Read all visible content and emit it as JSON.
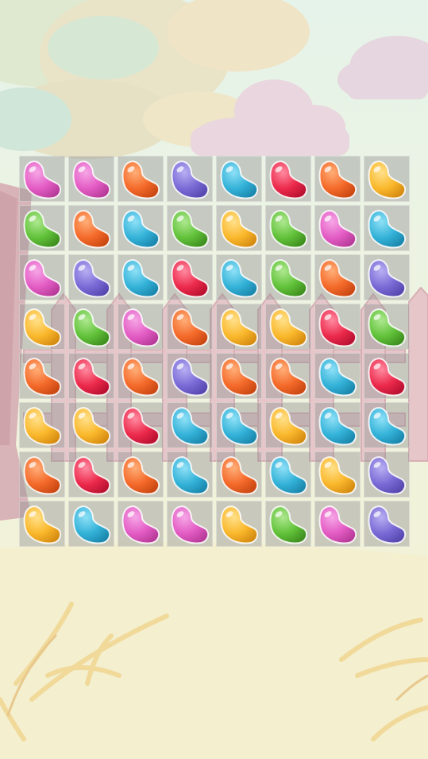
{
  "game": {
    "colors": {
      "pink": {
        "base": "#e35cc4",
        "light": "#f6a6e6",
        "dark": "#b63a98"
      },
      "orange": {
        "base": "#f46a2a",
        "light": "#ffae78",
        "dark": "#c94712"
      },
      "purple": {
        "base": "#7a6ad6",
        "light": "#b8aef2",
        "dark": "#5646ae"
      },
      "cyan": {
        "base": "#34b2d8",
        "light": "#8ee0f6",
        "dark": "#1a86ac"
      },
      "red": {
        "base": "#ec2a4c",
        "light": "#ff8aa0",
        "dark": "#b81030"
      },
      "green": {
        "base": "#62c23a",
        "light": "#aee890",
        "dark": "#3e8e1e"
      },
      "yellow": {
        "base": "#fab82c",
        "light": "#ffe08a",
        "dark": "#d48a10"
      }
    },
    "board": [
      [
        "pink",
        "pink",
        "orange",
        "purple",
        "cyan",
        "red",
        "orange",
        "yellow"
      ],
      [
        "green",
        "orange",
        "cyan",
        "green",
        "yellow",
        "green",
        "pink",
        "cyan"
      ],
      [
        "pink",
        "purple",
        "cyan",
        "red",
        "cyan",
        "green",
        "orange",
        "purple"
      ],
      [
        "yellow",
        "green",
        "pink",
        "orange",
        "yellow",
        "yellow",
        "red",
        "green"
      ],
      [
        "orange",
        "red",
        "orange",
        "purple",
        "orange",
        "orange",
        "cyan",
        "red"
      ],
      [
        "yellow",
        "yellow",
        "red",
        "cyan",
        "cyan",
        "yellow",
        "cyan",
        "cyan"
      ],
      [
        "orange",
        "red",
        "orange",
        "cyan",
        "orange",
        "cyan",
        "yellow",
        "purple"
      ],
      [
        "yellow",
        "cyan",
        "pink",
        "pink",
        "yellow",
        "green",
        "pink",
        "purple"
      ]
    ]
  }
}
